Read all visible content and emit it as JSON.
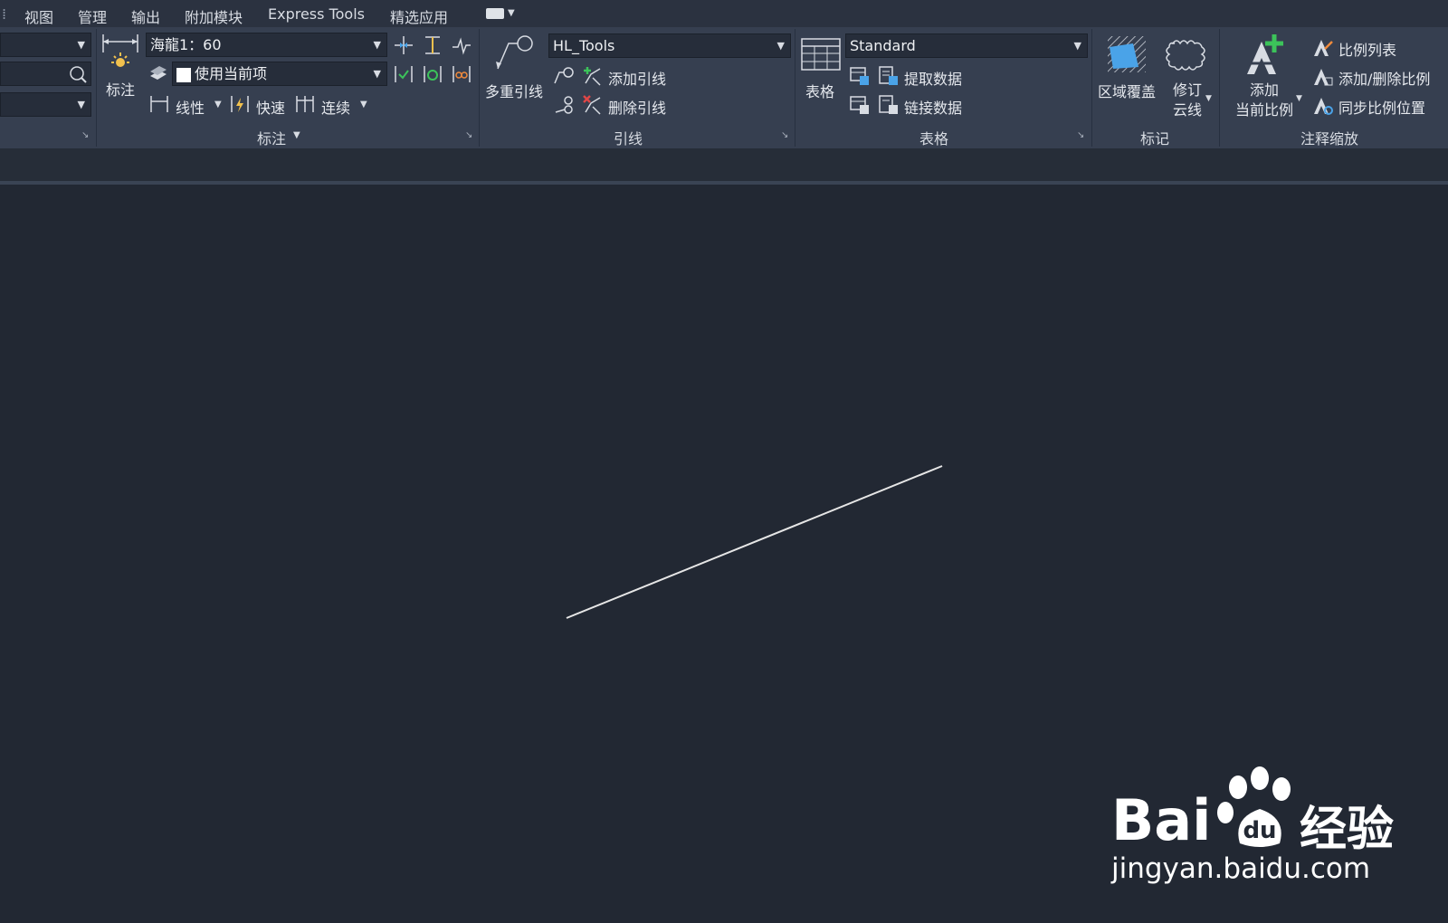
{
  "menu": {
    "items": [
      "视图",
      "管理",
      "输出",
      "附加模块",
      "Express Tools",
      "精选应用"
    ]
  },
  "dimension_panel": {
    "big_button_label": "标注",
    "style_combo": "海龍1：60",
    "layer_combo": "使用当前项",
    "linear_label": "线性",
    "quick_label": "快速",
    "continuous_label": "连续",
    "title": "标注"
  },
  "leader_panel": {
    "big_button_label": "多重引线",
    "style_combo": "HL_Tools",
    "add_label": "添加引线",
    "remove_label": "删除引线",
    "title": "引线"
  },
  "table_panel": {
    "big_button_label": "表格",
    "style_combo": "Standard",
    "extract_label": "提取数据",
    "link_label": "链接数据",
    "title": "表格"
  },
  "markup_panel": {
    "wipeout_label": "区域覆盖",
    "revcloud_label_1": "修订",
    "revcloud_label_2": "云线",
    "title": "标记"
  },
  "scale_panel": {
    "add_label_1": "添加",
    "add_label_2": "当前比例",
    "scale_list_label": "比例列表",
    "add_delete_label": "添加/删除比例",
    "sync_label": "同步比例位置",
    "title": "注释缩放"
  },
  "watermark": {
    "brand": "Bai",
    "brand_suffix": "经验",
    "url": "jingyan.baidu.com"
  },
  "colors": {
    "canvas": "#222833",
    "ribbon": "#363f50",
    "line": "#e6e6e6",
    "accent_blue": "#4aa3e8",
    "accent_green": "#3cc35a"
  }
}
